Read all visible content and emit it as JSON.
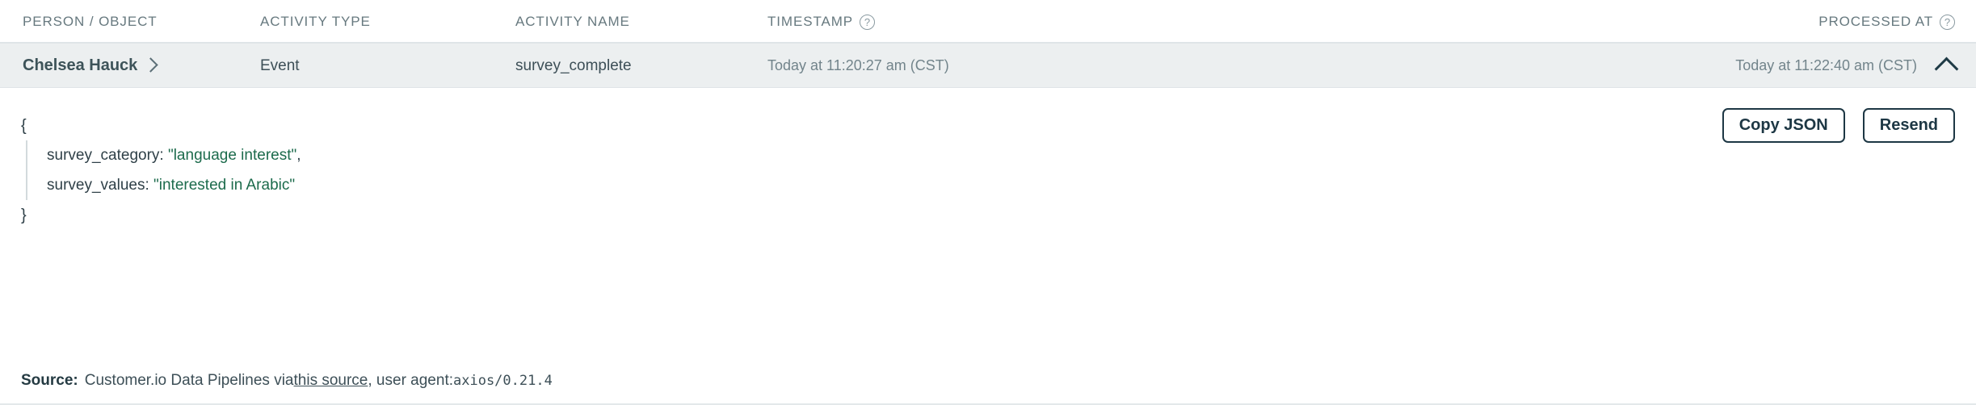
{
  "table": {
    "columns": [
      {
        "label": "PERSON / OBJECT",
        "help": false
      },
      {
        "label": "ACTIVITY TYPE",
        "help": false
      },
      {
        "label": "ACTIVITY NAME",
        "help": false
      },
      {
        "label": "TIMESTAMP",
        "help": true,
        "help_glyph": "?"
      },
      {
        "label": "PROCESSED AT",
        "help": true,
        "help_glyph": "?"
      }
    ]
  },
  "row": {
    "person": "Chelsea Hauck",
    "person_chevron": "chevron-right-icon",
    "activity_type": "Event",
    "activity_name": "survey_complete",
    "timestamp": "Today at 11:20:27 am (CST)",
    "processed_at": "Today at 11:22:40 am (CST)",
    "collapse_icon": "chevron-up-icon"
  },
  "detail": {
    "actions": {
      "copy_json": "Copy JSON",
      "resend": "Resend"
    },
    "json": {
      "open_brace": "{",
      "close_brace": "}",
      "lines": [
        {
          "key": "survey_category: ",
          "value": "\"language interest\"",
          "trailing": ","
        },
        {
          "key": "survey_values: ",
          "value": "\"interested in Arabic\"",
          "trailing": ""
        }
      ]
    },
    "source": {
      "label": "Source:",
      "prefix": "Customer.io Data Pipelines via ",
      "link": "this source",
      "middle": ", user agent: ",
      "user_agent": "axios/0.21.4"
    }
  },
  "colors": {
    "row_background": "#eceff0",
    "json_string": "#1c6b4c",
    "button_border": "#1d3744",
    "header_text": "#67797f"
  }
}
